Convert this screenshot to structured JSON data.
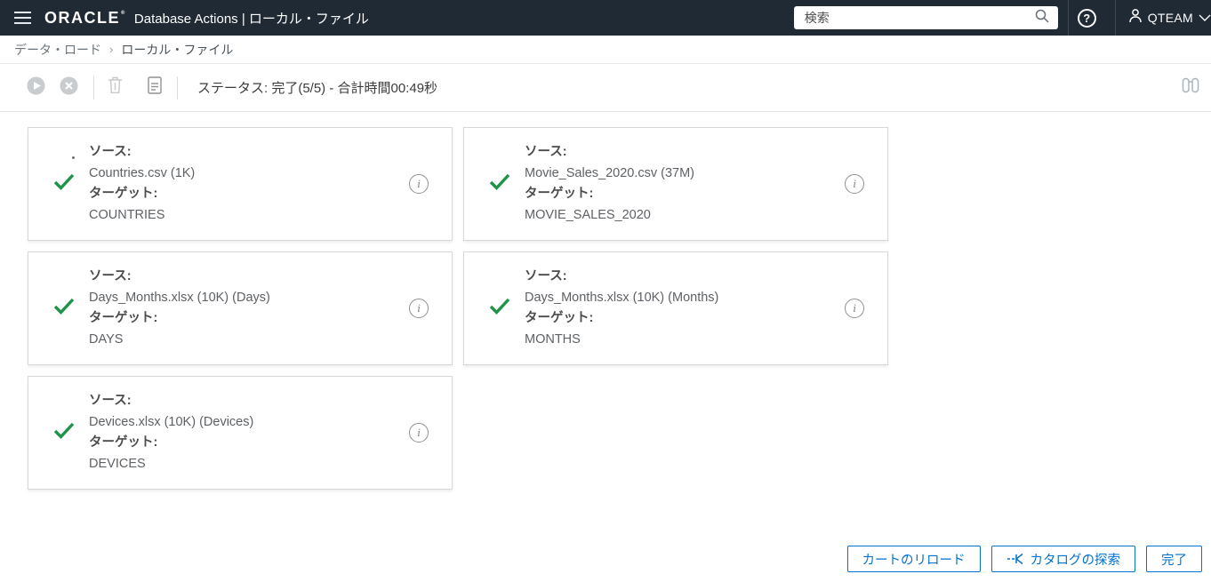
{
  "header": {
    "brand": "ORACLE",
    "brand_mark": "®",
    "title": "Database Actions | ローカル・ファイル",
    "search": {
      "placeholder": "検索"
    },
    "user": {
      "name": "QTEAM"
    }
  },
  "breadcrumb": {
    "parent": "データ・ロード",
    "separator": "›",
    "current": "ローカル・ファイル"
  },
  "toolbar": {
    "status": "ステータス: 完了(5/5) - 合計時間00:49秒"
  },
  "labels": {
    "source": "ソース:",
    "target": "ターゲット:"
  },
  "cards": [
    {
      "source": "Countries.csv (1K)",
      "target": "COUNTRIES"
    },
    {
      "source": "Movie_Sales_2020.csv (37M)",
      "target": "MOVIE_SALES_2020"
    },
    {
      "source": "Days_Months.xlsx (10K) (Days)",
      "target": "DAYS"
    },
    {
      "source": "Days_Months.xlsx (10K) (Months)",
      "target": "MONTHS"
    },
    {
      "source": "Devices.xlsx (10K) (Devices)",
      "target": "DEVICES"
    }
  ],
  "footer": {
    "reload_cart": "カートのリロード",
    "explore_catalog": "カタログの探索",
    "done": "完了"
  },
  "icons": {
    "menu": "hamburger",
    "search": "magnifier",
    "help": {
      "name": "question-circle",
      "glyph": "?"
    },
    "user": "person",
    "caret": "chevron-down",
    "run": "play-circle",
    "cancel": "x-circle",
    "delete": "trash",
    "report": "document",
    "find": "binoculars",
    "status_ok": "green-check",
    "info": {
      "name": "info-circle",
      "glyph": "i"
    },
    "explore": "branch-arrow"
  },
  "colors": {
    "header_bg": "#1f2a35",
    "accent": "#0572ce",
    "success": "#1e9448",
    "card_border": "#d8d8d8",
    "disabled_icon": "#c9cccf"
  }
}
